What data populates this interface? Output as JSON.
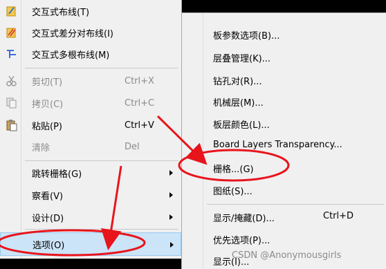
{
  "context_menu": {
    "items": [
      {
        "label": "交互式布线(T)",
        "icon": "interactive-routing-icon",
        "shortcut": "",
        "submenu": false,
        "enabled": true
      },
      {
        "label": "交互式差分对布线(I)",
        "icon": "diff-pair-routing-icon",
        "shortcut": "",
        "submenu": false,
        "enabled": true
      },
      {
        "label": "交互式多根布线(M)",
        "icon": "multi-routing-icon",
        "shortcut": "",
        "submenu": false,
        "enabled": true
      },
      {
        "label": "剪切(T)",
        "icon": "cut-icon",
        "shortcut": "Ctrl+X",
        "submenu": false,
        "enabled": false
      },
      {
        "label": "拷贝(C)",
        "icon": "copy-icon",
        "shortcut": "Ctrl+C",
        "submenu": false,
        "enabled": false
      },
      {
        "label": "粘贴(P)",
        "icon": "paste-icon",
        "shortcut": "Ctrl+V",
        "submenu": false,
        "enabled": true
      },
      {
        "label": "清除",
        "icon": "",
        "shortcut": "Del",
        "submenu": false,
        "enabled": false
      },
      {
        "label": "跳转栅格(G)",
        "icon": "",
        "shortcut": "",
        "submenu": true,
        "enabled": true
      },
      {
        "label": "察看(V)",
        "icon": "",
        "shortcut": "",
        "submenu": true,
        "enabled": true
      },
      {
        "label": "设计(D)",
        "icon": "",
        "shortcut": "",
        "submenu": true,
        "enabled": true
      },
      {
        "label": "选项(O)",
        "icon": "",
        "shortcut": "",
        "submenu": true,
        "enabled": true,
        "highlighted": true
      }
    ]
  },
  "options_submenu": {
    "items": [
      {
        "label": "板参数选项(B)...",
        "shortcut": ""
      },
      {
        "label": "层叠管理(K)...",
        "shortcut": ""
      },
      {
        "label": "钻孔对(R)...",
        "shortcut": ""
      },
      {
        "label": "机械层(M)...",
        "shortcut": ""
      },
      {
        "label": "板层颜色(L)...",
        "shortcut": ""
      },
      {
        "label": "Board Layers Transparency...",
        "shortcut": ""
      },
      {
        "label": "栅格...(G)",
        "shortcut": "",
        "annotated": true
      },
      {
        "label": "图纸(S)...",
        "shortcut": ""
      },
      {
        "label": "显示/掩藏(D)...",
        "shortcut": "Ctrl+D"
      },
      {
        "label": "优先选项(P)...",
        "shortcut": ""
      },
      {
        "label": "显示(I)...",
        "shortcut": ""
      }
    ]
  },
  "watermark": "CSDN @Anonymousgirls",
  "colors": {
    "menu_bg": "#f0f0f0",
    "highlight": "#cce4f7",
    "annotation_red": "#e8141c"
  }
}
